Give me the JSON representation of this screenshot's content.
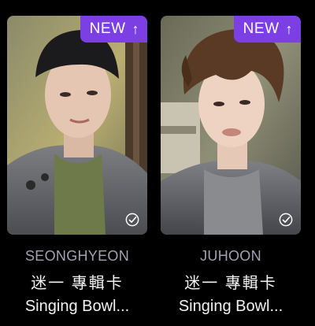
{
  "cards": [
    {
      "badge": "NEW",
      "name": "SEONGHYEON",
      "line1": "迷一 專輯卡",
      "line2": "Singing Bowl..."
    },
    {
      "badge": "NEW",
      "name": "JUHOON",
      "line1": "迷一 專輯卡",
      "line2": "Singing Bowl..."
    }
  ],
  "colors": {
    "badge": "#7b3fe4",
    "name": "#a2a2b2",
    "title": "#f2f2f2",
    "background": "#000000"
  },
  "icons": {
    "badge_arrow": "arrow-up-icon",
    "check": "check-circle-icon"
  }
}
